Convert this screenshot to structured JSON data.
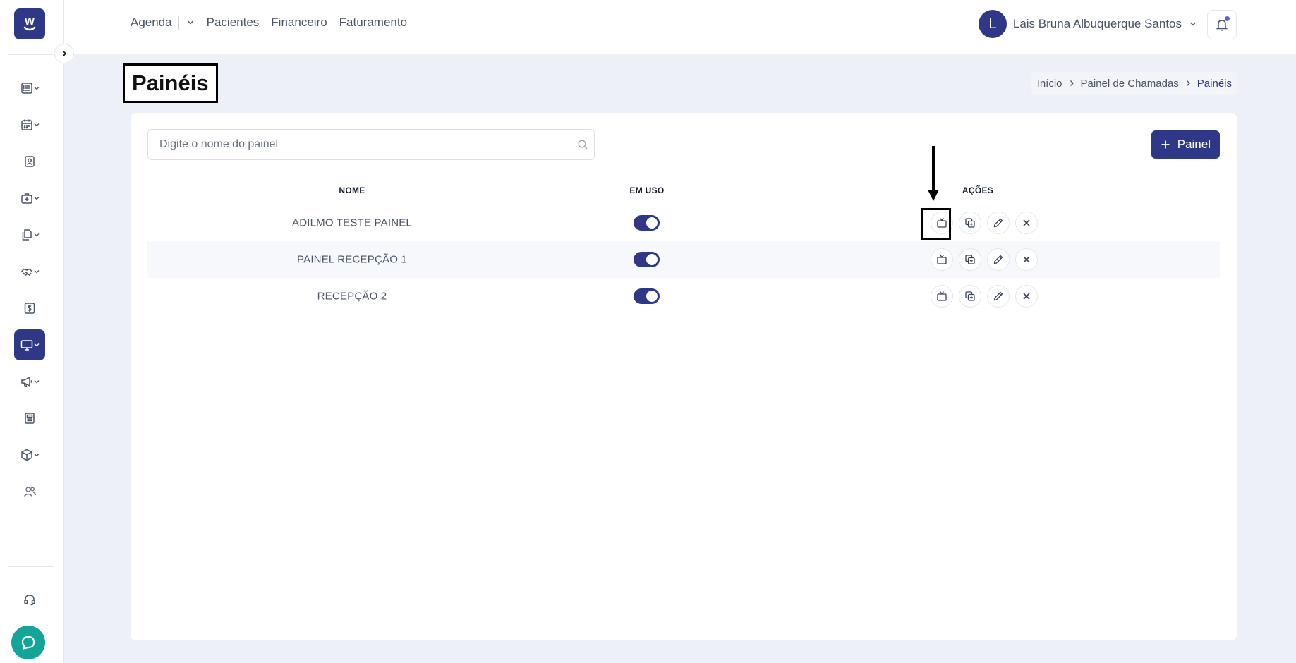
{
  "app": {
    "logo_icon": "w-logo-icon",
    "brand_color": "#2e3886"
  },
  "top_nav": {
    "items": [
      {
        "label": "Agenda"
      },
      {
        "label": "Pacientes"
      },
      {
        "label": "Financeiro"
      },
      {
        "label": "Faturamento"
      }
    ]
  },
  "user": {
    "avatar_letter": "L",
    "name": "Lais Bruna Albuquerque Santos",
    "notification_dot_color": "#5b5ff5"
  },
  "sidebar": {
    "items": [
      {
        "icon": "list-icon",
        "has_dropdown": true,
        "active": false
      },
      {
        "icon": "calendar-icon",
        "has_dropdown": true,
        "active": false
      },
      {
        "icon": "contact-card-icon",
        "has_dropdown": false,
        "active": false
      },
      {
        "icon": "medical-bag-icon",
        "has_dropdown": true,
        "active": false
      },
      {
        "icon": "documents-icon",
        "has_dropdown": true,
        "active": false
      },
      {
        "icon": "handshake-icon",
        "has_dropdown": true,
        "active": false
      },
      {
        "icon": "dollar-icon",
        "has_dropdown": false,
        "active": false
      },
      {
        "icon": "monitor-icon",
        "has_dropdown": true,
        "active": true
      },
      {
        "icon": "megaphone-icon",
        "has_dropdown": true,
        "active": false
      },
      {
        "icon": "newspaper-icon",
        "has_dropdown": false,
        "active": false
      },
      {
        "icon": "box-icon",
        "has_dropdown": true,
        "active": false
      },
      {
        "icon": "users-icon",
        "has_dropdown": false,
        "active": false
      },
      {
        "icon": "headset-icon",
        "has_dropdown": false,
        "active": false
      }
    ],
    "chat_icon": "chat-bubble-icon"
  },
  "page": {
    "title": "Painéis",
    "breadcrumb": [
      "Início",
      "Painel de Chamadas",
      "Painéis"
    ]
  },
  "search": {
    "placeholder": "Digite o nome do painel",
    "value": ""
  },
  "add_button": {
    "label": "Painel"
  },
  "table": {
    "headers": [
      "NOME",
      "EM USO",
      "AÇÕES"
    ],
    "rows": [
      {
        "name": "ADILMO TESTE PAINEL",
        "in_use": true
      },
      {
        "name": "PAINEL RECEPÇÃO 1",
        "in_use": true
      },
      {
        "name": "RECEPÇÃO 2",
        "in_use": true
      }
    ],
    "row_actions": [
      "tv-icon",
      "copy-icon",
      "edit-pencil-icon",
      "close-icon"
    ]
  }
}
